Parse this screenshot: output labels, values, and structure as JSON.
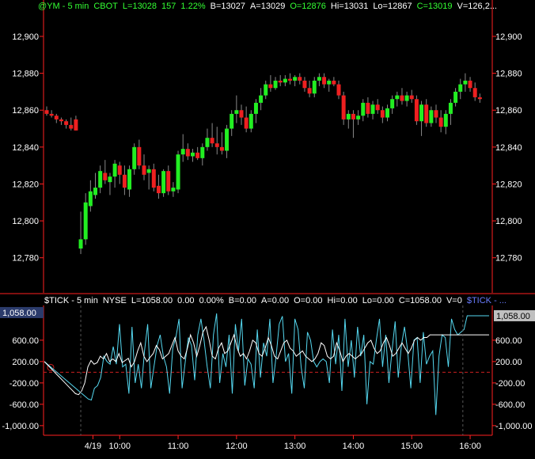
{
  "price_header": {
    "symbol": "@YM - 5 min",
    "exchange": "CBOT",
    "last": "L=13028",
    "change": "157",
    "pct": "1.22%",
    "bid": "B=13027",
    "ask": "A=13029",
    "open": "O=12876",
    "high": "Hi=13031",
    "low": "Lo=12867",
    "close": "C=13019",
    "volume": "V=126,2..."
  },
  "tick_header": {
    "symbol": "$TICK - 5 min",
    "exchange": "NYSE",
    "last": "L=1058.00",
    "change": "0.00",
    "pct": "0.00%",
    "bid": "B=0.00",
    "ask": "A=0.00",
    "open": "O=0.00",
    "high": "Hi=0.00",
    "low": "Lo=0.00",
    "close": "C=1058.00",
    "volume": "V=0",
    "tag": "$TICK - ..."
  },
  "colors": {
    "background": "#000000",
    "axis": "#ff2020",
    "up": "#22ee22",
    "down": "#ee2020",
    "wick": "#888888",
    "tick_line": "#55d8f0",
    "smooth_line": "#ffffff",
    "zero_line": "#cc2020",
    "current_value_box": "#c0c0c0",
    "left_value_box": "#2b3b6b"
  },
  "chart_data": [
    {
      "type": "candlestick",
      "title": "@YM - 5 min",
      "x_tick_labels": [
        "4/19",
        "10:00",
        "11:00",
        "12:00",
        "13:00",
        "14:00",
        "15:00",
        "16:00"
      ],
      "x_tick_bars": [
        9.5,
        15,
        27,
        39,
        51,
        63,
        75,
        87
      ],
      "y_ticks": [
        12780,
        12800,
        12820,
        12840,
        12860,
        12880,
        12900
      ],
      "y_tick_labels": [
        "12,780",
        "12,800",
        "12,820",
        "12,840",
        "12,860",
        "12,880",
        "12,900"
      ],
      "ylim": [
        12761,
        12912
      ],
      "bars": [
        {
          "o": 12860,
          "h": 12862,
          "l": 12857,
          "c": 12858
        },
        {
          "o": 12858,
          "h": 12860,
          "l": 12856,
          "c": 12857
        },
        {
          "o": 12857,
          "h": 12858,
          "l": 12853,
          "c": 12855
        },
        {
          "o": 12855,
          "h": 12856,
          "l": 12852,
          "c": 12854
        },
        {
          "o": 12854,
          "h": 12855,
          "l": 12850,
          "c": 12852
        },
        {
          "o": 12852,
          "h": 12856,
          "l": 12849,
          "c": 12850
        },
        {
          "o": 12855,
          "h": 12857,
          "l": 12849,
          "c": 12849
        },
        {
          "o": 12785,
          "h": 12805,
          "l": 12782,
          "c": 12790
        },
        {
          "o": 12790,
          "h": 12815,
          "l": 12787,
          "c": 12810
        },
        {
          "o": 12808,
          "h": 12822,
          "l": 12805,
          "c": 12816
        },
        {
          "o": 12814,
          "h": 12826,
          "l": 12812,
          "c": 12818
        },
        {
          "o": 12818,
          "h": 12830,
          "l": 12815,
          "c": 12827
        },
        {
          "o": 12826,
          "h": 12833,
          "l": 12820,
          "c": 12822
        },
        {
          "o": 12821,
          "h": 12826,
          "l": 12814,
          "c": 12824
        },
        {
          "o": 12824,
          "h": 12833,
          "l": 12818,
          "c": 12831
        },
        {
          "o": 12830,
          "h": 12832,
          "l": 12820,
          "c": 12825
        },
        {
          "o": 12825,
          "h": 12830,
          "l": 12814,
          "c": 12818
        },
        {
          "o": 12817,
          "h": 12830,
          "l": 12813,
          "c": 12828
        },
        {
          "o": 12828,
          "h": 12842,
          "l": 12825,
          "c": 12840
        },
        {
          "o": 12840,
          "h": 12844,
          "l": 12828,
          "c": 12830
        },
        {
          "o": 12830,
          "h": 12836,
          "l": 12822,
          "c": 12825
        },
        {
          "o": 12826,
          "h": 12830,
          "l": 12817,
          "c": 12828
        },
        {
          "o": 12828,
          "h": 12831,
          "l": 12816,
          "c": 12818
        },
        {
          "o": 12819,
          "h": 12825,
          "l": 12812,
          "c": 12815
        },
        {
          "o": 12815,
          "h": 12828,
          "l": 12813,
          "c": 12827
        },
        {
          "o": 12827,
          "h": 12830,
          "l": 12814,
          "c": 12816
        },
        {
          "o": 12816,
          "h": 12821,
          "l": 12813,
          "c": 12818
        },
        {
          "o": 12817,
          "h": 12838,
          "l": 12815,
          "c": 12836
        },
        {
          "o": 12836,
          "h": 12847,
          "l": 12832,
          "c": 12839
        },
        {
          "o": 12839,
          "h": 12842,
          "l": 12833,
          "c": 12835
        },
        {
          "o": 12835,
          "h": 12839,
          "l": 12832,
          "c": 12837
        },
        {
          "o": 12837,
          "h": 12840,
          "l": 12833,
          "c": 12834
        },
        {
          "o": 12834,
          "h": 12842,
          "l": 12830,
          "c": 12840
        },
        {
          "o": 12840,
          "h": 12850,
          "l": 12838,
          "c": 12845
        },
        {
          "o": 12845,
          "h": 12853,
          "l": 12840,
          "c": 12842
        },
        {
          "o": 12842,
          "h": 12851,
          "l": 12836,
          "c": 12840
        },
        {
          "o": 12840,
          "h": 12848,
          "l": 12836,
          "c": 12838
        },
        {
          "o": 12838,
          "h": 12852,
          "l": 12834,
          "c": 12850
        },
        {
          "o": 12850,
          "h": 12860,
          "l": 12846,
          "c": 12858
        },
        {
          "o": 12858,
          "h": 12868,
          "l": 12853,
          "c": 12860
        },
        {
          "o": 12860,
          "h": 12863,
          "l": 12852,
          "c": 12856
        },
        {
          "o": 12856,
          "h": 12862,
          "l": 12848,
          "c": 12850
        },
        {
          "o": 12850,
          "h": 12860,
          "l": 12848,
          "c": 12858
        },
        {
          "o": 12858,
          "h": 12866,
          "l": 12853,
          "c": 12864
        },
        {
          "o": 12864,
          "h": 12872,
          "l": 12860,
          "c": 12868
        },
        {
          "o": 12868,
          "h": 12876,
          "l": 12866,
          "c": 12874
        },
        {
          "o": 12874,
          "h": 12879,
          "l": 12870,
          "c": 12872
        },
        {
          "o": 12872,
          "h": 12878,
          "l": 12871,
          "c": 12876
        },
        {
          "o": 12876,
          "h": 12879,
          "l": 12873,
          "c": 12875
        },
        {
          "o": 12875,
          "h": 12879,
          "l": 12873,
          "c": 12877
        },
        {
          "o": 12877,
          "h": 12880,
          "l": 12874,
          "c": 12876
        },
        {
          "o": 12876,
          "h": 12879,
          "l": 12873,
          "c": 12878
        },
        {
          "o": 12878,
          "h": 12880,
          "l": 12874,
          "c": 12876
        },
        {
          "o": 12876,
          "h": 12878,
          "l": 12870,
          "c": 12872
        },
        {
          "o": 12872,
          "h": 12876,
          "l": 12867,
          "c": 12869
        },
        {
          "o": 12869,
          "h": 12878,
          "l": 12867,
          "c": 12876
        },
        {
          "o": 12876,
          "h": 12880,
          "l": 12873,
          "c": 12878
        },
        {
          "o": 12878,
          "h": 12880,
          "l": 12872,
          "c": 12874
        },
        {
          "o": 12874,
          "h": 12877,
          "l": 12870,
          "c": 12876
        },
        {
          "o": 12876,
          "h": 12878,
          "l": 12873,
          "c": 12874
        },
        {
          "o": 12874,
          "h": 12876,
          "l": 12866,
          "c": 12868
        },
        {
          "o": 12868,
          "h": 12870,
          "l": 12852,
          "c": 12855
        },
        {
          "o": 12855,
          "h": 12860,
          "l": 12850,
          "c": 12858
        },
        {
          "o": 12858,
          "h": 12860,
          "l": 12845,
          "c": 12855
        },
        {
          "o": 12855,
          "h": 12860,
          "l": 12852,
          "c": 12857
        },
        {
          "o": 12857,
          "h": 12866,
          "l": 12854,
          "c": 12864
        },
        {
          "o": 12864,
          "h": 12867,
          "l": 12856,
          "c": 12858
        },
        {
          "o": 12858,
          "h": 12865,
          "l": 12855,
          "c": 12863
        },
        {
          "o": 12863,
          "h": 12866,
          "l": 12858,
          "c": 12860
        },
        {
          "o": 12860,
          "h": 12862,
          "l": 12853,
          "c": 12856
        },
        {
          "o": 12856,
          "h": 12863,
          "l": 12854,
          "c": 12861
        },
        {
          "o": 12861,
          "h": 12868,
          "l": 12858,
          "c": 12866
        },
        {
          "o": 12866,
          "h": 12870,
          "l": 12862,
          "c": 12868
        },
        {
          "o": 12868,
          "h": 12872,
          "l": 12863,
          "c": 12865
        },
        {
          "o": 12865,
          "h": 12870,
          "l": 12862,
          "c": 12868
        },
        {
          "o": 12868,
          "h": 12871,
          "l": 12864,
          "c": 12866
        },
        {
          "o": 12866,
          "h": 12868,
          "l": 12852,
          "c": 12854
        },
        {
          "o": 12854,
          "h": 12865,
          "l": 12846,
          "c": 12863
        },
        {
          "o": 12863,
          "h": 12866,
          "l": 12851,
          "c": 12853
        },
        {
          "o": 12853,
          "h": 12862,
          "l": 12851,
          "c": 12860
        },
        {
          "o": 12860,
          "h": 12863,
          "l": 12853,
          "c": 12856
        },
        {
          "o": 12856,
          "h": 12860,
          "l": 12848,
          "c": 12851
        },
        {
          "o": 12851,
          "h": 12860,
          "l": 12847,
          "c": 12858
        },
        {
          "o": 12858,
          "h": 12866,
          "l": 12852,
          "c": 12864
        },
        {
          "o": 12864,
          "h": 12872,
          "l": 12862,
          "c": 12870
        },
        {
          "o": 12870,
          "h": 12877,
          "l": 12866,
          "c": 12874
        },
        {
          "o": 12874,
          "h": 12880,
          "l": 12870,
          "c": 12876
        },
        {
          "o": 12876,
          "h": 12878,
          "l": 12870,
          "c": 12872
        },
        {
          "o": 12872,
          "h": 12875,
          "l": 12865,
          "c": 12867
        },
        {
          "o": 12867,
          "h": 12869,
          "l": 12864,
          "c": 12866
        }
      ]
    },
    {
      "type": "line",
      "title": "$TICK - 5 min",
      "y_ticks": [
        -1000,
        -600,
        -200,
        200,
        600
      ],
      "y_tick_labels": [
        "-1,000.00",
        "-600.00",
        "-200.00",
        "200.00",
        "600.00"
      ],
      "ylim": [
        -1180,
        1250
      ],
      "current_value": 1058,
      "current_value_label": "1,058.00",
      "left_label": "1,058.00",
      "marker_value": 0,
      "x_tick_labels": [
        "4/19",
        "10:00",
        "11:00",
        "12:00",
        "13:00",
        "14:00",
        "15:00",
        "16:00"
      ],
      "tick_values": [
        200,
        150,
        100,
        50,
        0,
        -50,
        -100,
        -150,
        -200,
        -250,
        -300,
        -350,
        -400,
        -450,
        -500,
        -520,
        -300,
        -250,
        -100,
        300,
        200,
        150,
        480,
        150,
        900,
        100,
        150,
        -400,
        850,
        -200,
        150,
        -300,
        400,
        900,
        -300,
        100,
        500,
        700,
        300,
        100,
        -400,
        450,
        650,
        1000,
        -300,
        200,
        650,
        500,
        -150,
        700,
        1000,
        600,
        100,
        -300,
        700,
        1100,
        -200,
        350,
        100,
        700,
        -400,
        900,
        400,
        1000,
        -250,
        250,
        150,
        -300,
        800,
        -100,
        550,
        300,
        1000,
        -200,
        300,
        900,
        1050,
        200,
        350,
        -400,
        1000,
        800,
        100,
        -300,
        750,
        600,
        200,
        100,
        200,
        250,
        200,
        -200,
        800,
        150,
        700,
        -350,
        1000,
        100,
        600,
        -100,
        850,
        300,
        700,
        -600,
        200,
        150,
        600,
        1000,
        100,
        700,
        -200,
        400,
        950,
        -100,
        500,
        850,
        400,
        -300,
        600,
        650,
        -200,
        750,
        150,
        300,
        400,
        -800,
        300,
        700,
        650,
        100,
        1000,
        800,
        700,
        750,
        800,
        1058,
        1058,
        1058,
        1058,
        1058,
        1058,
        1058,
        1058
      ],
      "smooth_values": [
        200,
        140,
        80,
        20,
        -40,
        -100,
        -160,
        -220,
        -280,
        -340,
        -400,
        -420,
        -350,
        -200,
        100,
        220,
        150,
        180,
        300,
        250,
        350,
        200,
        250,
        200,
        350,
        180,
        220,
        260,
        100,
        200,
        400,
        550,
        300,
        200,
        280,
        350,
        500,
        420,
        250,
        300,
        350,
        500,
        650,
        400,
        300,
        250,
        450,
        700,
        550,
        300,
        500,
        750,
        850,
        600,
        300,
        250,
        450,
        550,
        350,
        400,
        550,
        700,
        450,
        300,
        350,
        250,
        400,
        600,
        550,
        350,
        300,
        450,
        650,
        500,
        300,
        250,
        400,
        550,
        600,
        450,
        400,
        300,
        350,
        400,
        300,
        250,
        200,
        250,
        350,
        550,
        500,
        300,
        250,
        300,
        550,
        400,
        200,
        300,
        350,
        300,
        250,
        300,
        350,
        450,
        550,
        600,
        450,
        350,
        400,
        550,
        650,
        500,
        300,
        350,
        450,
        550,
        450,
        350,
        450,
        600,
        650,
        600,
        650,
        650,
        700,
        700,
        700,
        700,
        700,
        700,
        700,
        700,
        700,
        700,
        700,
        700,
        700,
        700,
        700,
        700,
        700,
        700,
        700,
        700
      ]
    }
  ]
}
